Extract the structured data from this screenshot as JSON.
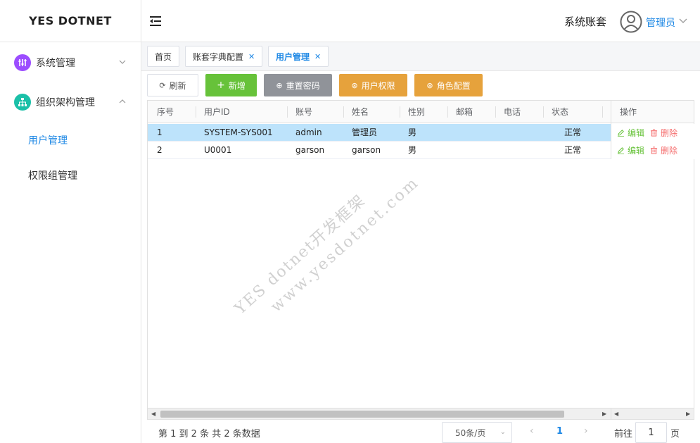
{
  "app": {
    "brand": "YES DOTNET"
  },
  "sidebar": {
    "menus": [
      {
        "label": "系统管理",
        "icon": "sliders-icon",
        "color": "#9c4dff",
        "expanded": false
      },
      {
        "label": "组织架构管理",
        "icon": "org-chart-icon",
        "color": "#1bc0a8",
        "expanded": true,
        "children": [
          {
            "label": "用户管理",
            "active": true
          },
          {
            "label": "权限组管理",
            "active": false
          }
        ]
      }
    ]
  },
  "header": {
    "account_set": "系统账套",
    "user_name": "管理员"
  },
  "tabs": [
    {
      "label": "首页",
      "closable": false
    },
    {
      "label": "账套字典配置",
      "closable": true
    },
    {
      "label": "用户管理",
      "closable": true,
      "active": true
    }
  ],
  "toolbar": {
    "refresh": "刷新",
    "add": "新增",
    "reset_password": "重置密码",
    "user_permission": "用户权限",
    "role_config": "角色配置"
  },
  "table": {
    "columns": [
      "序号",
      "用户ID",
      "账号",
      "姓名",
      "性别",
      "邮箱",
      "电话",
      "状态",
      "操作"
    ],
    "rows": [
      {
        "index": "1",
        "user_id": "SYSTEM-SYS001",
        "account": "admin",
        "name": "管理员",
        "gender": "男",
        "email": "",
        "phone": "",
        "status": "正常",
        "selected": true
      },
      {
        "index": "2",
        "user_id": "U0001",
        "account": "garson",
        "name": "garson",
        "gender": "男",
        "email": "",
        "phone": "",
        "status": "正常",
        "selected": false
      }
    ],
    "edit_label": "编辑",
    "delete_label": "删除"
  },
  "watermark": {
    "line1": "YES dotnet开发框架",
    "line2": "www.yesdotnet.com"
  },
  "pagination": {
    "summary": "第 1 到 2 条 共 2 条数据",
    "page_size": "50条/页",
    "current_page": "1",
    "goto_label": "前往",
    "goto_value": "1",
    "goto_unit": "页"
  }
}
